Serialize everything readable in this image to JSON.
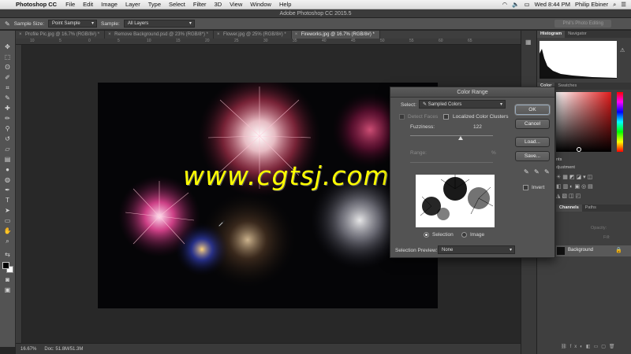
{
  "menubar": {
    "app_name": "Photoshop CC",
    "items": [
      "File",
      "Edit",
      "Image",
      "Layer",
      "Type",
      "Select",
      "Filter",
      "3D",
      "View",
      "Window",
      "Help"
    ],
    "clock": "Wed 8:44 PM",
    "user": "Philip Ebiner"
  },
  "window_title": "Adobe Photoshop CC 2015.5",
  "options": {
    "sample_size_label": "Sample Size:",
    "sample_size_value": "Point Sample",
    "sample_label": "Sample:",
    "sample_value": "All Layers",
    "workspace": "Phil's Photo Editing"
  },
  "tabs": [
    {
      "label": "Profile Pic.jpg @ 16.7% (RGB/8#) *",
      "active": false
    },
    {
      "label": "Remove Background.psd @ 23% (RGB/8*) *",
      "active": false
    },
    {
      "label": "Flower.jpg @ 25% (RGB/8#) *",
      "active": false
    },
    {
      "label": "Fireworks.jpg @ 16.7% (RGB/8#) *",
      "active": true
    }
  ],
  "ruler_ticks": [
    "10",
    "5",
    "0",
    "5",
    "10",
    "15",
    "20",
    "25",
    "30",
    "35",
    "40",
    "45",
    "50",
    "55",
    "60",
    "65"
  ],
  "status": {
    "zoom": "16.67%",
    "doc": "Doc: 51.8M/51.3M"
  },
  "watermark": "www.cgtsj.com",
  "panels": {
    "histogram_tab": "Histogram",
    "navigator_tab": "Navigator",
    "color_tab": "Color",
    "swatches_tab": "Swatches",
    "adjustments_label": "djustment",
    "channels_tab": "Channels",
    "paths_tab": "Paths",
    "opacity_label": "Opacity:",
    "fill_label": "Fill:",
    "layer_name": "Background",
    "partial_tab": "nts"
  },
  "color_range": {
    "title": "Color Range",
    "select_label": "Select:",
    "select_value": "Sampled Colors",
    "detect_faces": "Detect Faces",
    "localized_clusters": "Localized Color Clusters",
    "fuzziness_label": "Fuzziness:",
    "fuzziness_value": "122",
    "fuzziness_max": 200,
    "range_label": "Range:",
    "range_unit": "%",
    "selection_radio": "Selection",
    "image_radio": "Image",
    "preview_label": "Selection Preview:",
    "preview_value": "None",
    "ok": "OK",
    "cancel": "Cancel",
    "load": "Load...",
    "save": "Save...",
    "invert": "Invert"
  },
  "colors": {
    "watermark": "#ffff00",
    "canvas_bg": "#282828",
    "ui_gray": "#535353"
  }
}
